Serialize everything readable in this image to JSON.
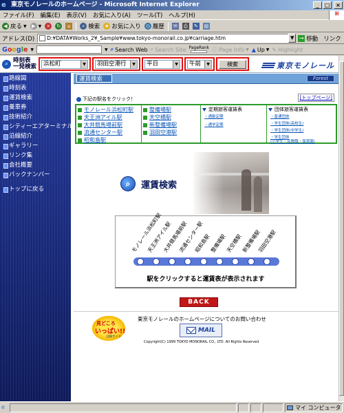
{
  "window": {
    "title": "東京モノレールのホームページ - Microsoft Internet Explorer",
    "buttons": {
      "minimize": "_",
      "maximize": "□",
      "close": "×"
    }
  },
  "menu": [
    "ファイル(F)",
    "編集(E)",
    "表示(V)",
    "お気に入り(A)",
    "ツール(T)",
    "ヘルプ(H)"
  ],
  "toolbar": {
    "back": "戻る",
    "search": "検索",
    "favorites": "お気に入り",
    "history": "履歴"
  },
  "address": {
    "label": "アドレス(D)",
    "value": "D:¥DATA¥Works_2¥_Sample¥www.tokyo-monorail.co.jp¥carriage.htm",
    "go": "移動",
    "links": "リンク"
  },
  "google": {
    "logo": [
      "G",
      "o",
      "o",
      "g",
      "l",
      "e"
    ],
    "search_web": "Search Web",
    "search_site": "Search Site",
    "pagerank": "PageRank",
    "page_info": "Page Info",
    "up": "Up",
    "highlight": "Highlight"
  },
  "search_bar": {
    "label_line1": "時刻表",
    "label_line2": "一発検索",
    "from_station": "浜松町",
    "to_station": "羽田空港行",
    "day_type": "平日",
    "time_of_day": "午前",
    "search_button": "検索",
    "brand": "東京モノレール"
  },
  "nav": {
    "items": [
      "路線図",
      "時刻表",
      "運賃検索",
      "乗車券",
      "技術紹介",
      "シティーエアターミナル",
      "沿線紹介",
      "ギャラリー",
      "リンク集",
      "会社概要",
      "バックナンバー"
    ],
    "back_to_top": "トップに戻る"
  },
  "fare": {
    "title": "運賃検索",
    "badge": "Forest",
    "prompt": "下記の駅名をクリック！",
    "top_link": "[トップページ]",
    "stations_col1": [
      "モノレール浜松町駅",
      "天王洲アイル駅",
      "大井競馬場前駅",
      "流通センター駅",
      "昭和島駅"
    ],
    "stations_col2": [
      "整備場駅",
      "天空橋駅",
      "新整備場駅",
      "羽田空港駅"
    ],
    "commuter_pass": {
      "title": "定期旅客運賃表",
      "links": [
        "・通勤定期",
        "・通学定期"
      ]
    },
    "group_fare": {
      "title": "団体旅客運賃表",
      "links": [
        "・普通団体",
        "・学生団体(高校生)",
        "・学生団体(中学生)",
        "・学生団体",
        "(小学生・及教職・保育園)"
      ]
    }
  },
  "hero": {
    "title": "運賃検索"
  },
  "route_map": {
    "stations": [
      "モノレール浜松町駅",
      "天王洲アイル駅",
      "大井競馬場前駅",
      "流通センター駅",
      "昭和島駅",
      "整備場駅",
      "天空橋駅",
      "新整備場駅",
      "羽田空港駅"
    ],
    "caption": "駅をクリックすると運賃表が表示されます"
  },
  "back_button": "BACK",
  "footer": {
    "mascot_line1": "見どころ",
    "mascot_line2": "いっぱい!!",
    "mascot_line3": "沿線ガイド",
    "contact": "東京モノレールのホームページについてのお問い合わせ",
    "mail": "MAIL",
    "copyright": "Copyright(C) 1999 TOKYO MONORAIL CO., LTD. All Rights Reserved"
  },
  "status": {
    "zone": "マイ コンピュータ"
  },
  "colors": {
    "nav_bg": "#1c2f8c",
    "fare_bar": "#6fa3d9",
    "route_line": "#5a78d8",
    "highlight_box": "#e01010",
    "back_button": "#c01818"
  }
}
